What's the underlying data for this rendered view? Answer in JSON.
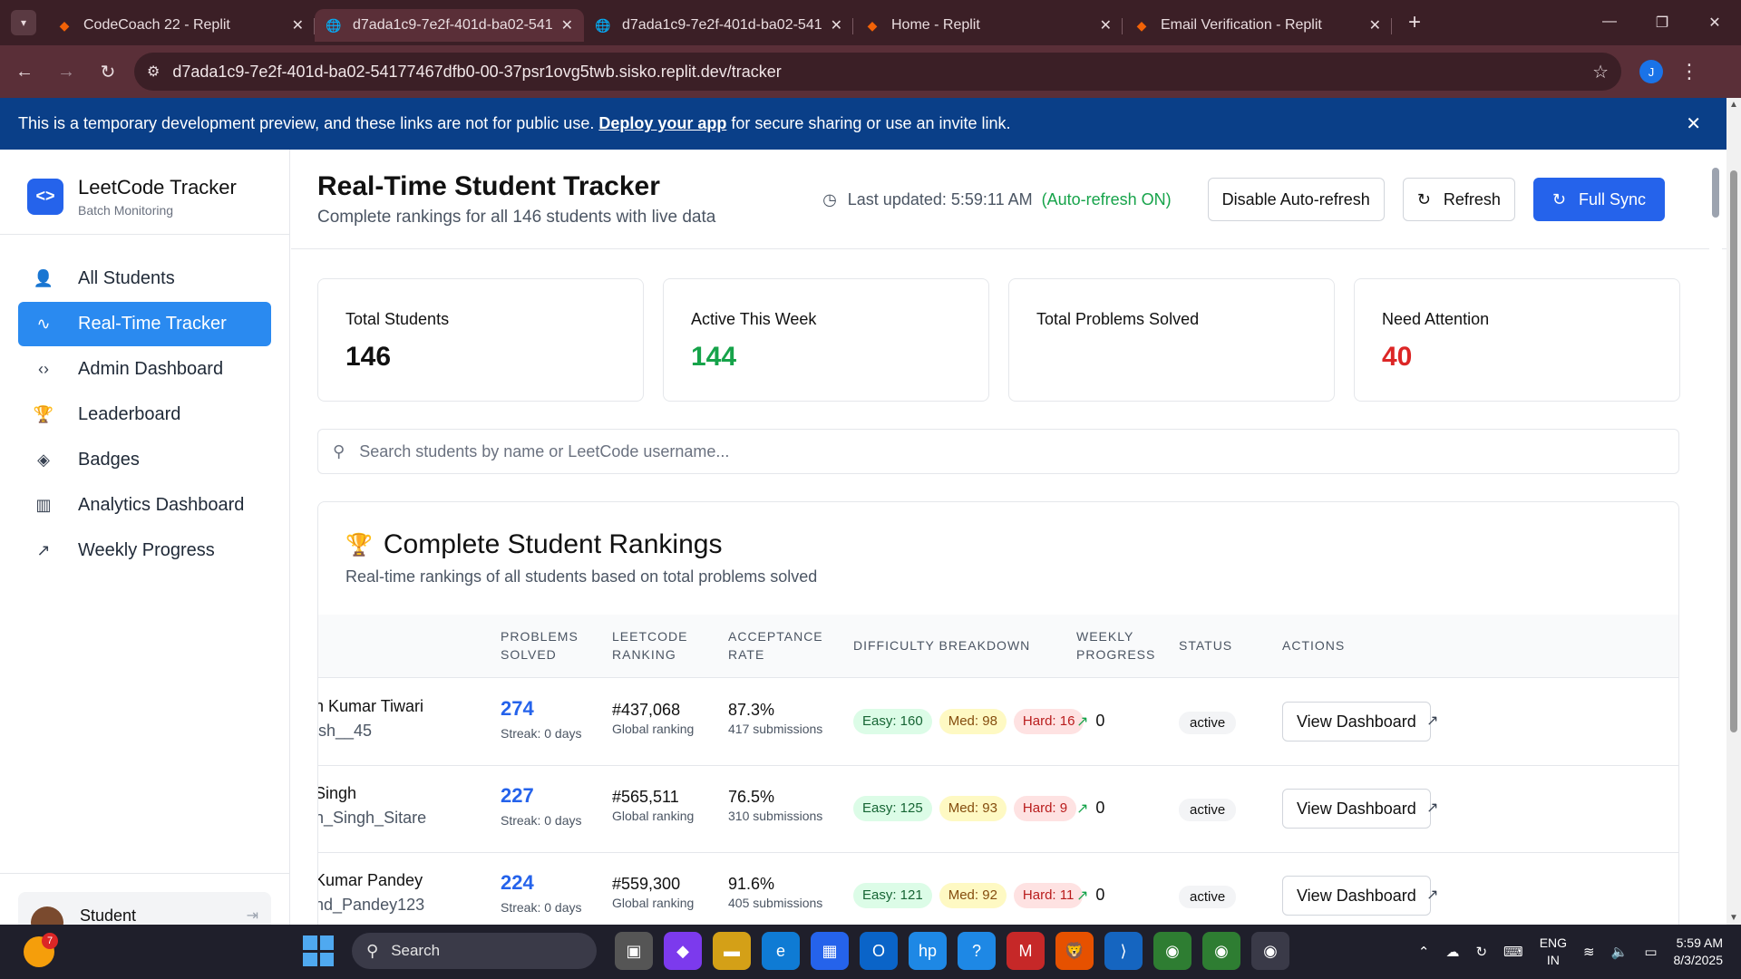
{
  "browser": {
    "tabs": [
      {
        "title": "CodeCoach 22 - Replit",
        "icon": "replit-icon",
        "active": false
      },
      {
        "title": "d7ada1c9-7e2f-401d-ba02-541",
        "icon": "globe-icon",
        "active": true
      },
      {
        "title": "d7ada1c9-7e2f-401d-ba02-541",
        "icon": "globe-icon",
        "active": false
      },
      {
        "title": "Home - Replit",
        "icon": "replit-icon",
        "active": false
      },
      {
        "title": "Email Verification - Replit",
        "icon": "replit-icon",
        "active": false
      }
    ],
    "url": "d7ada1c9-7e2f-401d-ba02-54177467dfb0-00-37psr1ovg5twb.sisko.replit.dev/tracker",
    "profile_initial": "J"
  },
  "banner": {
    "text_before": "This is a temporary development preview, and these links are not for public use. ",
    "link": "Deploy your app",
    "text_after": " for secure sharing or use an invite link."
  },
  "sidebar": {
    "brand_title": "LeetCode Tracker",
    "brand_sub": "Batch Monitoring",
    "items": [
      {
        "label": "All Students",
        "icon": "users-icon",
        "glyph": "👤"
      },
      {
        "label": "Real-Time Tracker",
        "icon": "activity-icon",
        "glyph": "∿",
        "active": true
      },
      {
        "label": "Admin Dashboard",
        "icon": "code-icon",
        "glyph": "‹›"
      },
      {
        "label": "Leaderboard",
        "icon": "trophy-icon",
        "glyph": "🏆"
      },
      {
        "label": "Badges",
        "icon": "badge-icon",
        "glyph": "◈"
      },
      {
        "label": "Analytics Dashboard",
        "icon": "bar-chart-icon",
        "glyph": "▥"
      },
      {
        "label": "Weekly Progress",
        "icon": "trending-up-icon",
        "glyph": "↗"
      }
    ],
    "user_name": "Student"
  },
  "header": {
    "title": "Real-Time Student Tracker",
    "subtitle": "Complete rankings for all 146 students with live data",
    "last_updated": "Last updated: 5:59:11 AM",
    "auto_refresh": "(Auto-refresh ON)",
    "disable_btn": "Disable Auto-refresh",
    "refresh_btn": "Refresh",
    "sync_btn": "Full Sync"
  },
  "stats": [
    {
      "label": "Total Students",
      "value": "146",
      "color": "#111111"
    },
    {
      "label": "Active This Week",
      "value": "144",
      "color": "#16a34a"
    },
    {
      "label": "Total Problems Solved",
      "value": "",
      "color": "#111111"
    },
    {
      "label": "Need Attention",
      "value": "40",
      "color": "#dc2626"
    }
  ],
  "search": {
    "placeholder": "Search students by name or LeetCode username..."
  },
  "rankings": {
    "title": "Complete Student Rankings",
    "subtitle": "Real-time rankings of all students based on total problems solved",
    "columns": {
      "solved": [
        "PROBLEMS",
        "SOLVED"
      ],
      "ranking": [
        "LEETCODE",
        "RANKING"
      ],
      "acceptance": [
        "ACCEPTANCE",
        "RATE"
      ],
      "difficulty": "DIFFICULTY BREAKDOWN",
      "weekly": [
        "WEEKLY",
        "PROGRESS"
      ],
      "status": "STATUS",
      "actions": "ACTIONS"
    },
    "rows": [
      {
        "name": "n Kumar Tiwari",
        "username": "ish__45",
        "solved": "274",
        "streak": "Streak: 0 days",
        "ranking": "#437,068",
        "ranking_sub": "Global ranking",
        "acceptance": "87.3%",
        "submissions": "417 submissions",
        "easy": "Easy: 160",
        "med": "Med: 98",
        "hard": "Hard: 16",
        "weekly": "0",
        "status": "active",
        "action": "View Dashboard"
      },
      {
        "name": "Singh",
        "username": "n_Singh_Sitare",
        "solved": "227",
        "streak": "Streak: 0 days",
        "ranking": "#565,511",
        "ranking_sub": "Global ranking",
        "acceptance": "76.5%",
        "submissions": "310 submissions",
        "easy": "Easy: 125",
        "med": "Med: 93",
        "hard": "Hard: 9",
        "weekly": "0",
        "status": "active",
        "action": "View Dashboard"
      },
      {
        "name": "Kumar Pandey",
        "username": "nd_Pandey123",
        "solved": "224",
        "streak": "Streak: 0 days",
        "ranking": "#559,300",
        "ranking_sub": "Global ranking",
        "acceptance": "91.6%",
        "submissions": "405 submissions",
        "easy": "Easy: 121",
        "med": "Med: 92",
        "hard": "Hard: 11",
        "weekly": "0",
        "status": "active",
        "action": "View Dashboard"
      }
    ]
  },
  "taskbar": {
    "weather_badge": "7",
    "search": "Search",
    "lang": [
      "ENG",
      "IN"
    ],
    "time": "5:59 AM",
    "date": "8/3/2025"
  }
}
